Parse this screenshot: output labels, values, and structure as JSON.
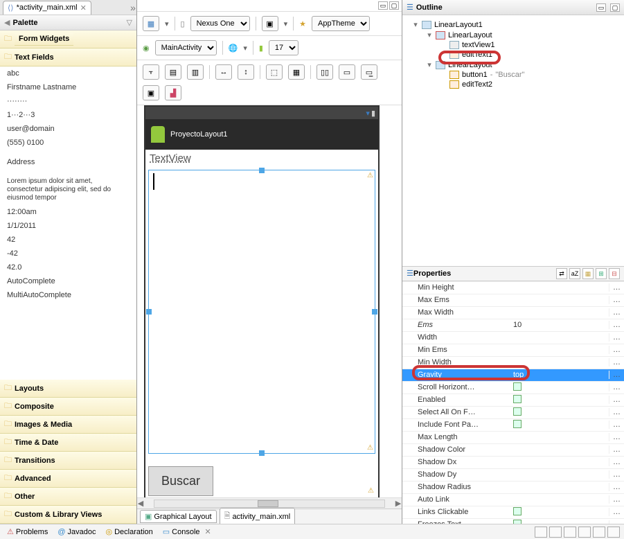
{
  "editor_tab": {
    "title": "*activity_main.xml"
  },
  "palette": {
    "title": "Palette",
    "groups": {
      "form_widgets": "Form Widgets",
      "text_fields": "Text Fields",
      "layouts": "Layouts",
      "composite": "Composite",
      "images_media": "Images & Media",
      "time_date": "Time & Date",
      "transitions": "Transitions",
      "advanced": "Advanced",
      "other": "Other",
      "custom_library": "Custom & Library Views"
    },
    "text_fields_items": [
      "abc",
      "Firstname Lastname",
      "········",
      "1···2···3",
      "user@domain",
      "(555) 0100",
      "",
      "Address",
      "",
      "Lorem ipsum dolor sit amet, consectetur adipiscing elit, sed do eiusmod tempor",
      "12:00am",
      "1/1/2011",
      "42",
      "-42",
      "42.0",
      "AutoComplete",
      "MultiAutoComplete"
    ]
  },
  "toolbar": {
    "device": "Nexus One",
    "activity": "MainActivity",
    "theme": "AppTheme",
    "api": "17"
  },
  "phone": {
    "app_title": "ProyectoLayout1",
    "textview": "TextView",
    "button": "Buscar"
  },
  "bottom_tabs": {
    "graphical": "Graphical Layout",
    "xml": "activity_main.xml"
  },
  "outline": {
    "title": "Outline",
    "nodes": {
      "root": "LinearLayout1",
      "ll1": "LinearLayout",
      "tv1": "textView1",
      "et1": "editText1",
      "ll2": "LinearLayout",
      "btn1_label": "button1",
      "btn1_text": "\"Buscar\"",
      "et2": "editText2"
    }
  },
  "properties": {
    "title": "Properties",
    "rows": [
      {
        "key": "Min Height",
        "val": "",
        "type": "text"
      },
      {
        "key": "Max Ems",
        "val": "",
        "type": "text"
      },
      {
        "key": "Max Width",
        "val": "",
        "type": "text"
      },
      {
        "key": "Ems",
        "val": "10",
        "type": "text",
        "italic": true
      },
      {
        "key": "Width",
        "val": "",
        "type": "text"
      },
      {
        "key": "Min Ems",
        "val": "",
        "type": "text"
      },
      {
        "key": "Min Width",
        "val": "",
        "type": "text"
      },
      {
        "key": "Gravity",
        "val": "top",
        "type": "text",
        "selected": true
      },
      {
        "key": "Scroll Horizont…",
        "val": "",
        "type": "bool"
      },
      {
        "key": "Enabled",
        "val": "",
        "type": "bool"
      },
      {
        "key": "Select All On F…",
        "val": "",
        "type": "bool"
      },
      {
        "key": "Include Font Pa…",
        "val": "",
        "type": "bool"
      },
      {
        "key": "Max Length",
        "val": "",
        "type": "text"
      },
      {
        "key": "Shadow Color",
        "val": "",
        "type": "text"
      },
      {
        "key": "Shadow Dx",
        "val": "",
        "type": "text"
      },
      {
        "key": "Shadow Dy",
        "val": "",
        "type": "text"
      },
      {
        "key": "Shadow Radius",
        "val": "",
        "type": "text"
      },
      {
        "key": "Auto Link",
        "val": "",
        "type": "text"
      },
      {
        "key": "Links Clickable",
        "val": "",
        "type": "bool"
      },
      {
        "key": "Freezes Text",
        "val": "",
        "type": "bool"
      }
    ]
  },
  "status": {
    "problems": "Problems",
    "javadoc": "Javadoc",
    "declaration": "Declaration",
    "console": "Console"
  }
}
